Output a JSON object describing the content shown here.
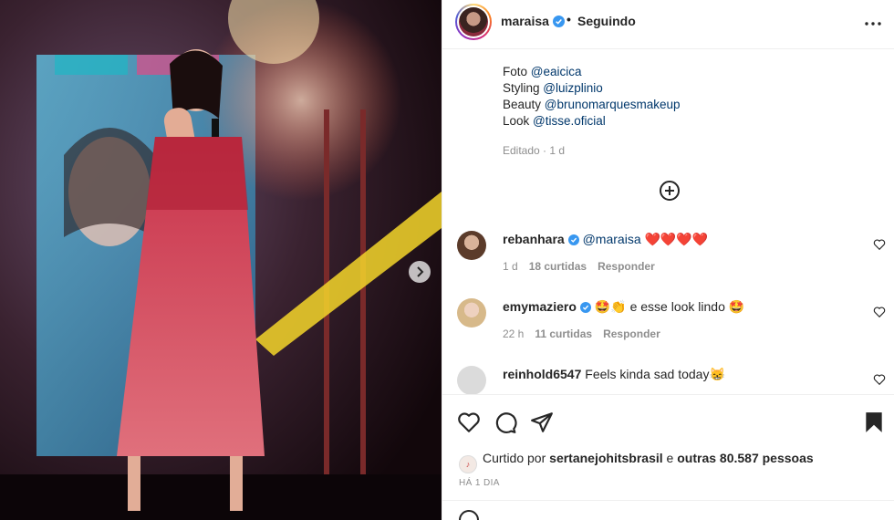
{
  "post": {
    "username": "maraisa",
    "follow_label": "Seguindo",
    "separator": "•"
  },
  "caption": {
    "lines": [
      {
        "prefix": "Foto ",
        "mention": "@eaicica"
      },
      {
        "prefix": "Styling ",
        "mention": "@luizplinio"
      },
      {
        "prefix": "Beauty ",
        "mention": "@brunomarquesmakeup"
      },
      {
        "prefix": "Look ",
        "mention": "@tisse.oficial"
      }
    ],
    "edited": "Editado · 1 d"
  },
  "comments": [
    {
      "username": "rebanhara",
      "verified": true,
      "mention": "@maraisa",
      "text": " ❤️❤️❤️❤️",
      "time": "1 d",
      "likes": "18 curtidas",
      "reply": "Responder"
    },
    {
      "username": "emymaziero",
      "verified": true,
      "mention": "",
      "text": "🤩👏 e esse look lindo 🤩",
      "time": "22 h",
      "likes": "11 curtidas",
      "reply": "Responder"
    },
    {
      "username": "reinhold6547",
      "verified": false,
      "mention": "",
      "text": "Feels kinda sad today😸",
      "time": "",
      "likes": "",
      "reply": ""
    }
  ],
  "likes_line": {
    "prefix": "Curtido por ",
    "user": "sertanejohitsbrasil",
    "middle": " e ",
    "others": "outras 80.587 pessoas"
  },
  "time_ago": "HÁ 1 DIA",
  "icons": {
    "verified": "verified-badge-icon",
    "more": "more-options-icon",
    "add": "plus-circle-icon",
    "like": "heart-icon",
    "comment": "comment-icon",
    "share": "send-icon",
    "save": "bookmark-icon",
    "next": "chevron-right-icon"
  },
  "colors": {
    "link": "#00376b",
    "verified": "#3897f0",
    "meta": "#8e8e8e"
  }
}
